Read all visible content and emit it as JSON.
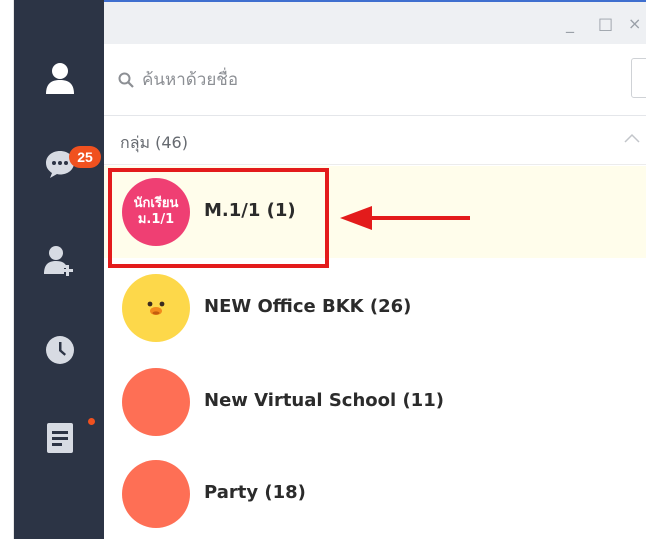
{
  "window": {
    "controls": {
      "minimize": "_",
      "maximize": "□",
      "close": "×"
    }
  },
  "sidebar": {
    "items": [
      {
        "name": "profile",
        "icon": "person-icon"
      },
      {
        "name": "chats",
        "icon": "chat-bubble-icon",
        "badge": "25"
      },
      {
        "name": "add-friend",
        "icon": "add-friend-icon"
      },
      {
        "name": "timeline",
        "icon": "clock-icon"
      },
      {
        "name": "notes",
        "icon": "note-icon",
        "has_dot": true
      }
    ],
    "colors": {
      "background": "#2c3445",
      "icon": "#d7dbe3",
      "badge": "#f0511f"
    }
  },
  "search": {
    "placeholder": "ค้นหาด้วยชื่อ",
    "value": ""
  },
  "groups": {
    "header": "กลุ่ม (46)",
    "items": [
      {
        "name": "M.1/1 (1)",
        "avatar_text": [
          "นักเรียน",
          "ม.1/1"
        ],
        "avatar_color": "#ef3f73",
        "selected": true
      },
      {
        "name": "NEW Office BKK (26)",
        "avatar_icon": "duck-icon",
        "avatar_color": "#fdd84a",
        "selected": false
      },
      {
        "name": "New Virtual School (11)",
        "avatar_color": "#fe6f55",
        "selected": false
      },
      {
        "name": "Party (18)",
        "avatar_color": "#fe6f55",
        "selected": false
      }
    ]
  },
  "annotation": {
    "color": "#e31b1b"
  }
}
